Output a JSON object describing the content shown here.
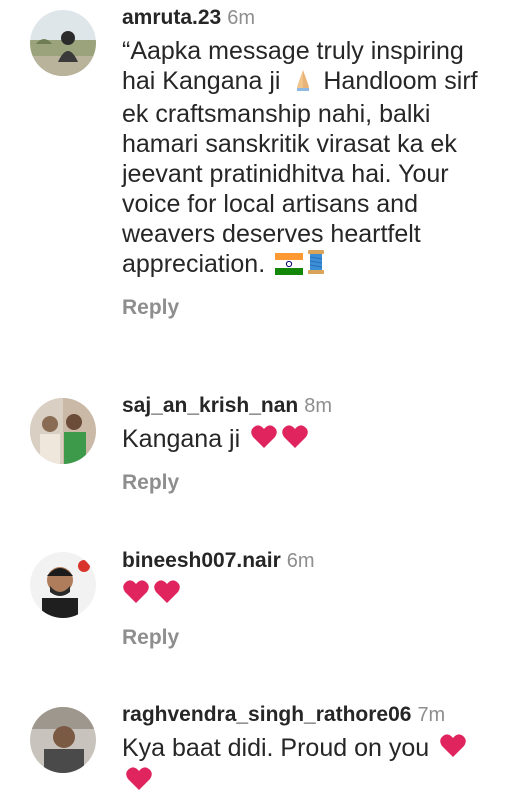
{
  "comments": [
    {
      "username": "amruta.23",
      "time": "6m",
      "text": "“Aapka message truly inspiring hai Kangana ji",
      "text_line2": "Handloom sirf ek craftsmanship nahi, balki hamari sanskritik virasat ka ek jeevant pratinidhitva hai. Your voice for local artisans and weavers deserves heartfelt appreciation.",
      "reply": "Reply"
    },
    {
      "username": "saj_an_krish_nan",
      "time": "8m",
      "text": "Kangana ji",
      "reply": "Reply"
    },
    {
      "username": "bineesh007.nair",
      "time": "6m",
      "text": "",
      "reply": "Reply"
    },
    {
      "username": "raghvendra_singh_rathore06",
      "time": "7m",
      "text": "Kya baat didi. Proud on you"
    }
  ],
  "icons": {
    "heart": "red-heart-icon",
    "folded_hands": "folded-hands-icon",
    "india_flag": "india-flag-icon",
    "thread_spool": "thread-spool-icon"
  },
  "colors": {
    "text": "#262626",
    "secondary": "#8e8e8e",
    "heart": "#e0245e"
  }
}
